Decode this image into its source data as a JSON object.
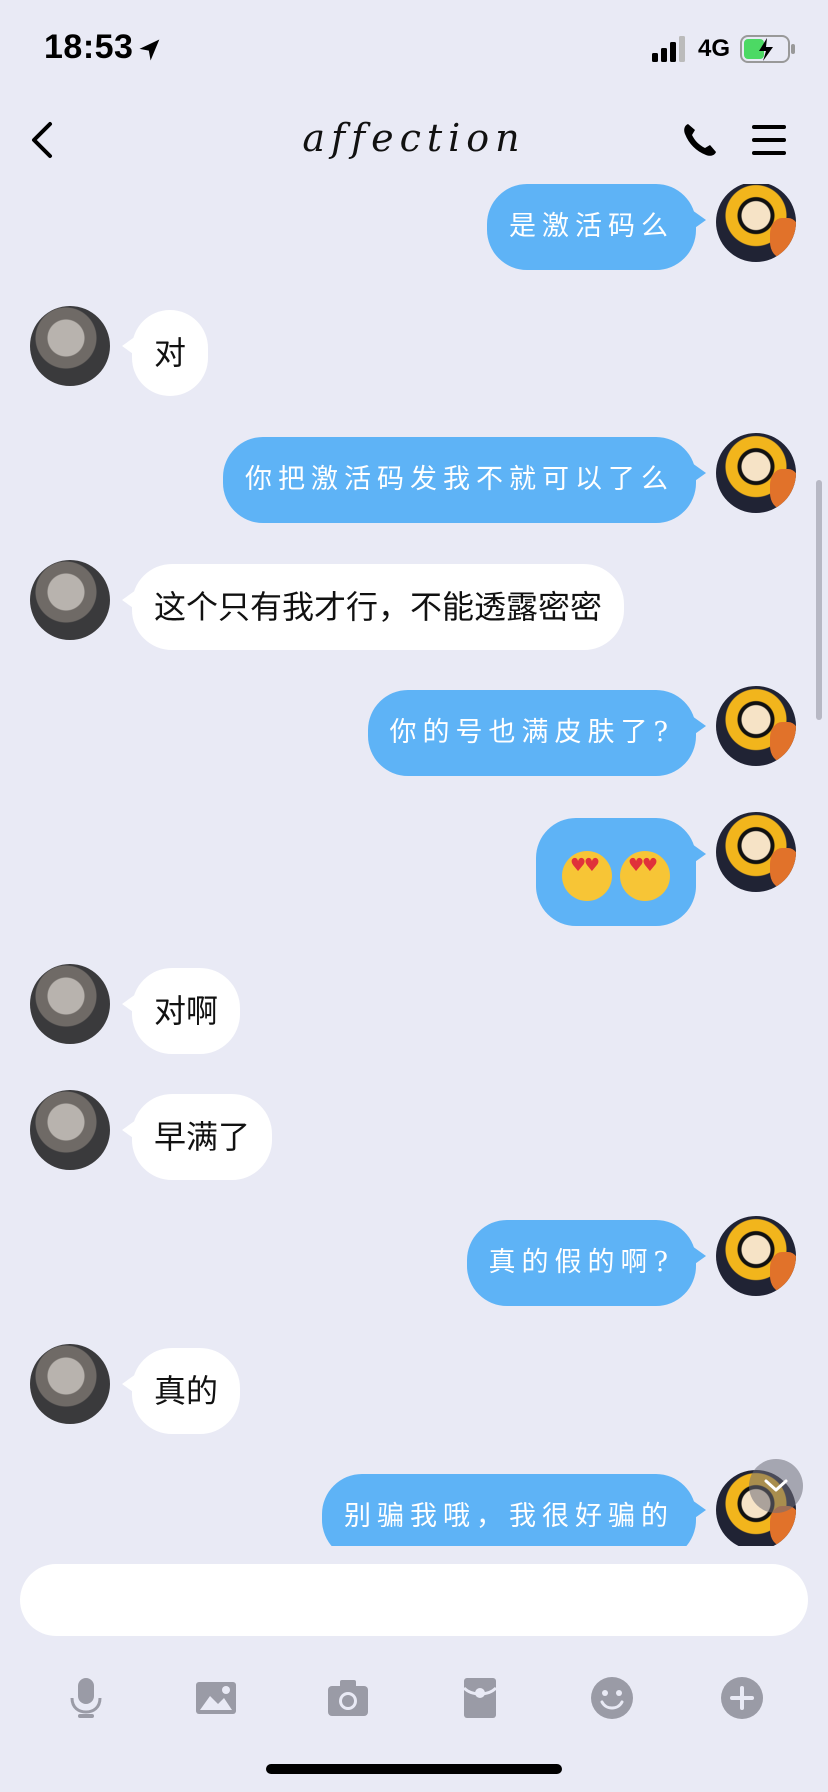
{
  "status": {
    "time": "18:53",
    "network": "4G"
  },
  "header": {
    "title": "affection"
  },
  "messages": [
    {
      "from": "self",
      "text": "是激活码么"
    },
    {
      "from": "other",
      "text": "对"
    },
    {
      "from": "self",
      "text": "你把激活码发我不就可以了么"
    },
    {
      "from": "other",
      "text": "这个只有我才行，不能透露密密"
    },
    {
      "from": "self",
      "text": "你的号也满皮肤了?"
    },
    {
      "from": "self",
      "text": "😍😍"
    },
    {
      "from": "other",
      "text": "对啊"
    },
    {
      "from": "other",
      "text": "早满了"
    },
    {
      "from": "self",
      "text": "真的假的啊?"
    },
    {
      "from": "other",
      "text": "真的"
    },
    {
      "from": "self",
      "text": "别骗我哦，我很好骗的"
    }
  ],
  "composer": {
    "placeholder": ""
  },
  "toolbar": [
    "mic-icon",
    "image-icon",
    "camera-icon",
    "red-packet-icon",
    "emoji-icon",
    "plus-icon"
  ],
  "colors": {
    "background": "#e9eaf5",
    "self_bubble": "#5eb3f6",
    "other_bubble": "#ffffff"
  }
}
